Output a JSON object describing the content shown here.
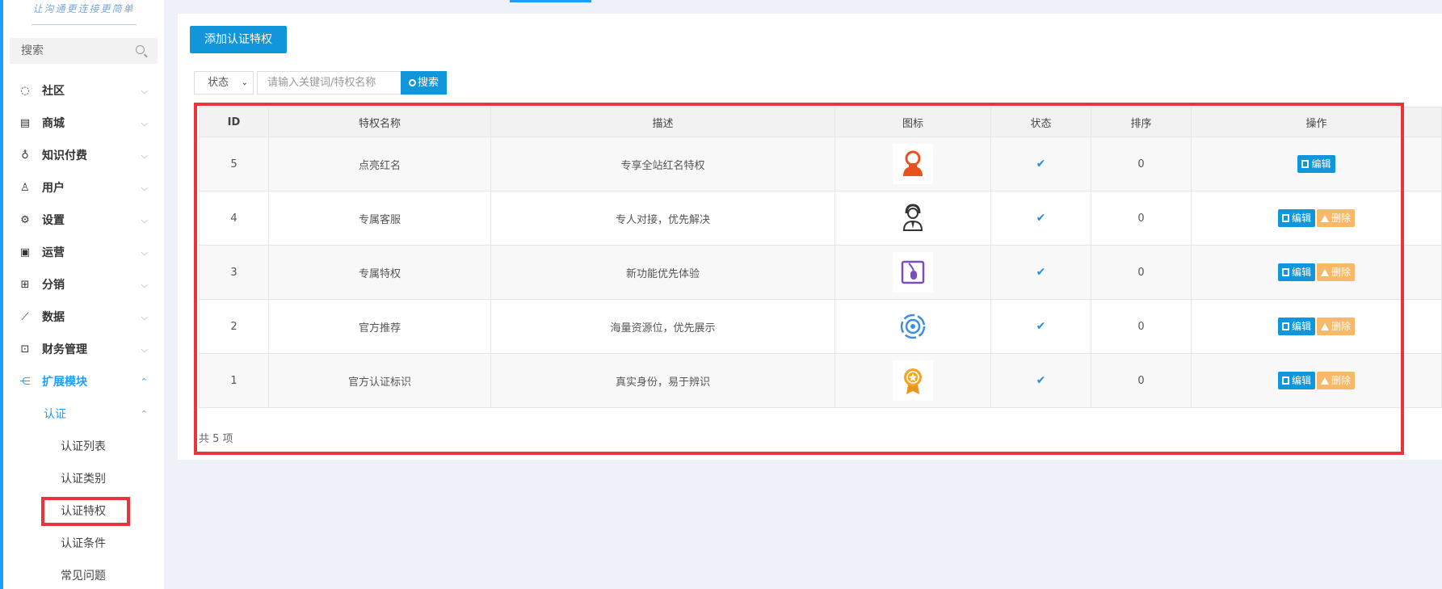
{
  "logo_text": "让沟通更连接更简单",
  "sidebar": {
    "search_placeholder": "搜索",
    "items": [
      {
        "label": "社区",
        "icon": "chat-icon"
      },
      {
        "label": "商城",
        "icon": "store-icon"
      },
      {
        "label": "知识付费",
        "icon": "bulb-icon"
      },
      {
        "label": "用户",
        "icon": "user-icon"
      },
      {
        "label": "设置",
        "icon": "gear-icon"
      },
      {
        "label": "运营",
        "icon": "monitor-icon"
      },
      {
        "label": "分销",
        "icon": "hierarchy-icon"
      },
      {
        "label": "数据",
        "icon": "chart-icon"
      },
      {
        "label": "财务管理",
        "icon": "finance-icon"
      },
      {
        "label": "扩展模块",
        "icon": "extension-icon"
      }
    ],
    "sub_head": "认证",
    "sub_items": [
      "认证列表",
      "认证类别",
      "认证特权",
      "认证条件",
      "常见问题"
    ]
  },
  "toolbar": {
    "add_label": "添加认证特权",
    "status_label": "状态",
    "keyword_placeholder": "请输入关键词/特权名称",
    "search_label": "搜索"
  },
  "table": {
    "headers": [
      "ID",
      "特权名称",
      "描述",
      "图标",
      "状态",
      "排序",
      "操作"
    ],
    "rows": [
      {
        "id": "5",
        "name": "点亮红名",
        "desc": "专享全站红名特权",
        "icon": "red-avatar-icon",
        "sort": "0",
        "deletable": false
      },
      {
        "id": "4",
        "name": "专属客服",
        "desc": "专人对接，优先解决",
        "icon": "customer-service-icon",
        "sort": "0",
        "deletable": true
      },
      {
        "id": "3",
        "name": "专属特权",
        "desc": "新功能优先体验",
        "icon": "new-feature-icon",
        "sort": "0",
        "deletable": true
      },
      {
        "id": "2",
        "name": "官方推荐",
        "desc": "海量资源位，优先展示",
        "icon": "target-icon",
        "sort": "0",
        "deletable": true
      },
      {
        "id": "1",
        "name": "官方认证标识",
        "desc": "真实身份，易于辨识",
        "icon": "medal-icon",
        "sort": "0",
        "deletable": true
      }
    ],
    "edit_label": "编辑",
    "delete_label": "删除",
    "total": "共 5 项"
  }
}
